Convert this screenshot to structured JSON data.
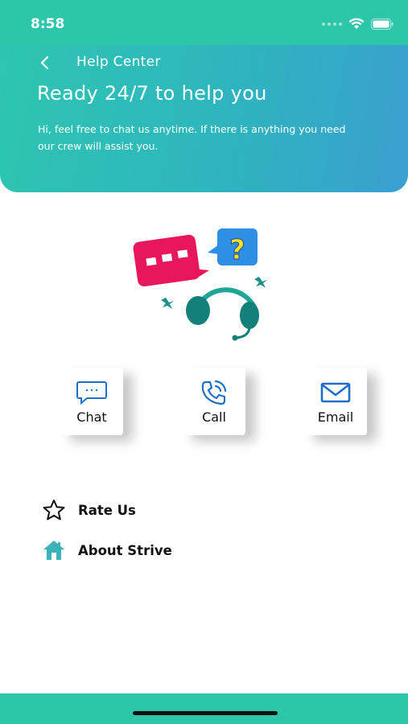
{
  "status_bar": {
    "time": "8:58"
  },
  "header": {
    "title": "Help Center",
    "headline": "Ready 24/7 to help you",
    "subtext": "Hi, feel free to chat us anytime. If there is anything you need our crew will assist you."
  },
  "contact_options": [
    {
      "label": "Chat",
      "icon": "chat-bubble-icon"
    },
    {
      "label": "Call",
      "icon": "phone-call-icon"
    },
    {
      "label": "Email",
      "icon": "envelope-icon"
    }
  ],
  "links": [
    {
      "label": "Rate Us",
      "icon": "star-icon"
    },
    {
      "label": "About Strive",
      "icon": "house-icon"
    }
  ],
  "colors": {
    "primary_teal": "#2ec6ab",
    "header_blue": "#3a9fd0",
    "icon_blue": "#1f6fc9",
    "house_teal": "#3bb3b8"
  }
}
